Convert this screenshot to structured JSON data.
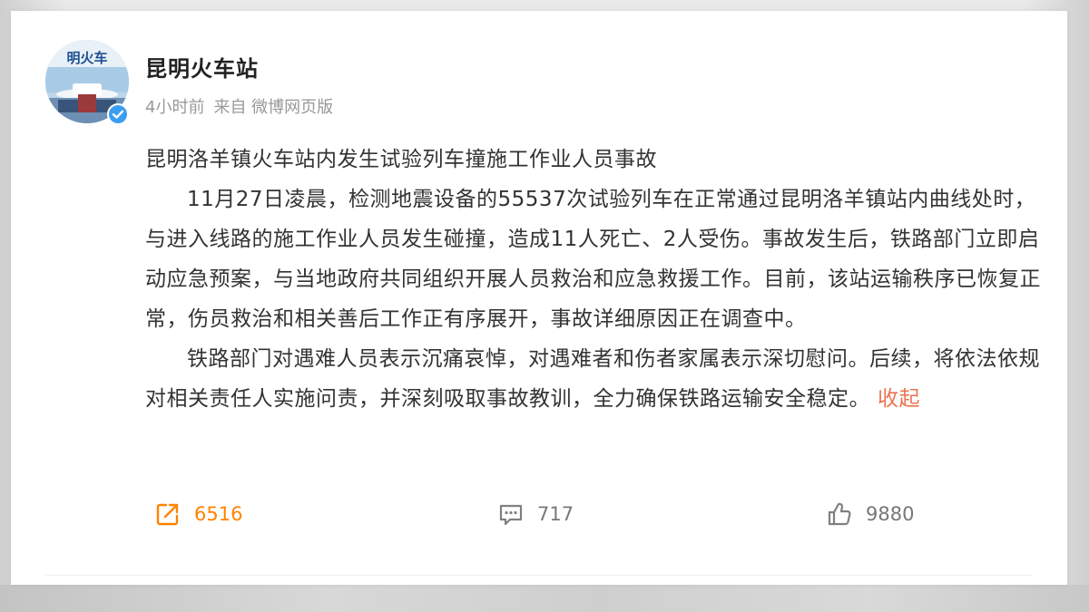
{
  "post": {
    "author": "昆明火车站",
    "avatar_text": "明火车",
    "meta": {
      "time": "4小时前",
      "source": "来自 微博网页版"
    },
    "title": "昆明洛羊镇火车站内发生试验列车撞施工作业人员事故",
    "paragraphs": [
      "11月27日凌晨，检测地震设备的55537次试验列车在正常通过昆明洛羊镇站内曲线处时，与进入线路的施工作业人员发生碰撞，造成11人死亡、2人受伤。事故发生后，铁路部门立即启动应急预案，与当地政府共同组织开展人员救治和应急救援工作。目前，该站运输秩序已恢复正常，伤员救治和相关善后工作正有序展开，事故详细原因正在调查中。",
      "铁路部门对遇难人员表示沉痛哀悼，对遇难者和伤者家属表示深切慰问。后续，将依法依规对相关责任人实施问责，并深刻吸取事故教训，全力确保铁路运输安全稳定。"
    ],
    "collapse_label": "收起"
  },
  "actions": {
    "share_count": "6516",
    "comment_count": "717",
    "like_count": "9880"
  },
  "colors": {
    "accent_orange": "#ff8200",
    "collapse_link": "#eb7350",
    "verified_blue": "#3a9ef0",
    "text": "#333333",
    "meta": "#999999"
  },
  "icons": {
    "share": "share-icon",
    "comment": "comment-icon",
    "like": "thumb-up-icon",
    "verified": "verified-badge-icon"
  }
}
